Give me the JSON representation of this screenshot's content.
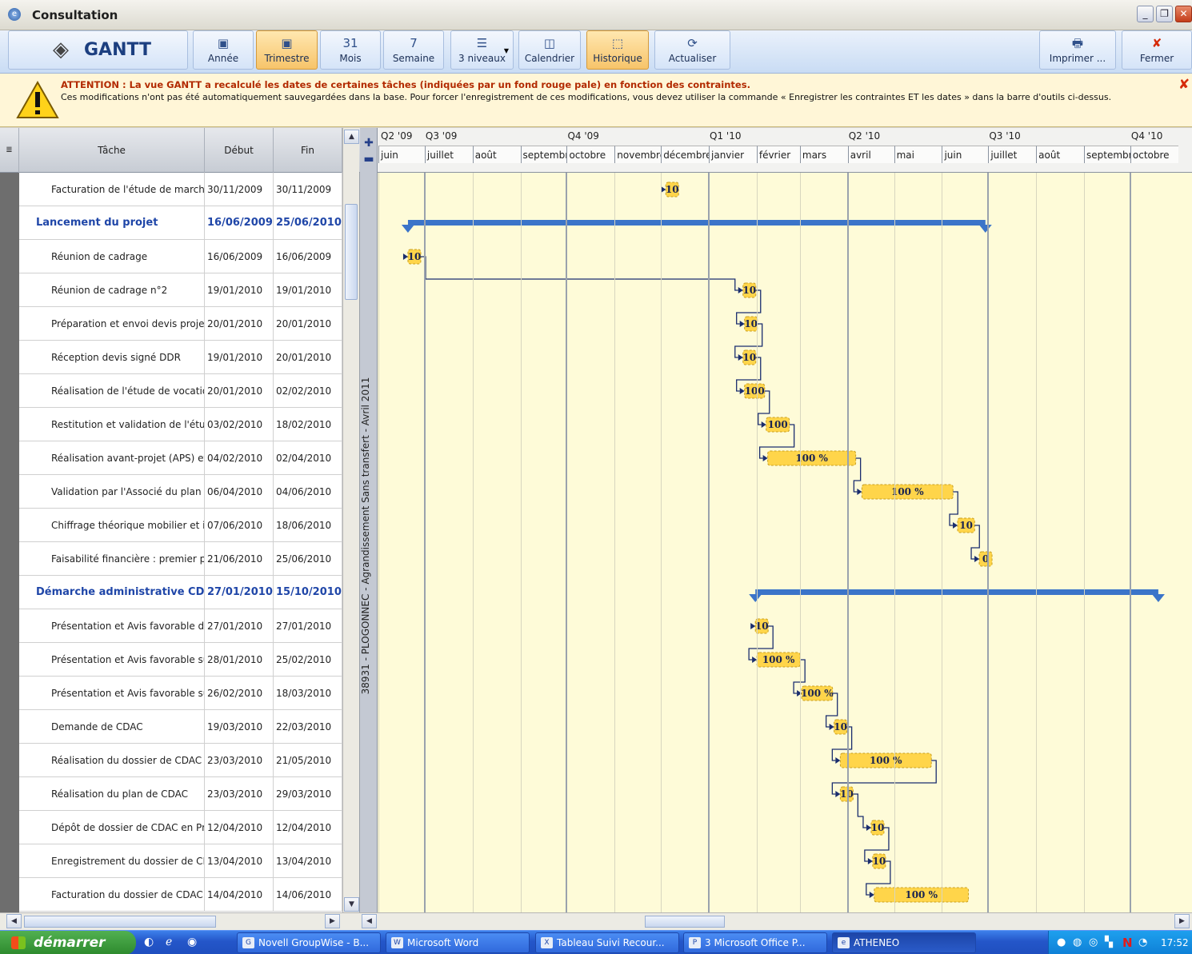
{
  "window": {
    "title": "Consultation",
    "icon": "ie-window-icon"
  },
  "toolbar": {
    "logo": "GANTT",
    "buttons": [
      {
        "label": "Année",
        "icon": "calendar-year-icon",
        "glyph": "▣"
      },
      {
        "label": "Trimestre",
        "icon": "calendar-quarter-icon",
        "glyph": "▣"
      },
      {
        "label": "Mois",
        "icon": "calendar-month-icon",
        "glyph": "31"
      },
      {
        "label": "Semaine",
        "icon": "calendar-week-icon",
        "glyph": "7"
      },
      {
        "label": "3 niveaux",
        "icon": "levels-icon",
        "glyph": "☰"
      },
      {
        "label": "Calendrier",
        "icon": "calendar-icon",
        "glyph": "◫"
      },
      {
        "label": "Historique",
        "icon": "history-icon",
        "glyph": "⬚"
      },
      {
        "label": "Actualiser",
        "icon": "refresh-icon",
        "glyph": "⟳"
      }
    ],
    "print_label": "Imprimer ...",
    "close_label": "Fermer"
  },
  "warning": {
    "title": "ATTENTION : La vue GANTT a recalculé les dates de certaines tâches (indiquées par un fond rouge pale) en fonction des contraintes.",
    "body": "Ces modifications n'ont pas été automatiquement sauvegardées dans la base. Pour forcer l'enregistrement de ces modifications, vous devez utiliser la commande « Enregistrer les contraintes ET les dates » dans la barre d'outils ci-dessus."
  },
  "table": {
    "headers": [
      "Tâche",
      "Début",
      "Fin"
    ],
    "rows": [
      {
        "task": "Facturation de l'étude de marché",
        "start": "30/11/2009",
        "end": "30/11/2009",
        "group": false
      },
      {
        "task": "Lancement du projet",
        "start": "16/06/2009",
        "end": "25/06/2010",
        "group": true
      },
      {
        "task": "Réunion de cadrage",
        "start": "16/06/2009",
        "end": "16/06/2009",
        "group": false
      },
      {
        "task": "Réunion de cadrage n°2",
        "start": "19/01/2010",
        "end": "19/01/2010",
        "group": false
      },
      {
        "task": "Préparation et envoi devis projet I",
        "start": "20/01/2010",
        "end": "20/01/2010",
        "group": false
      },
      {
        "task": "Réception devis signé DDR",
        "start": "19/01/2010",
        "end": "20/01/2010",
        "group": false
      },
      {
        "task": "Réalisation de l'étude de vocation",
        "start": "20/01/2010",
        "end": "02/02/2010",
        "group": false
      },
      {
        "task": "Restitution et validation de l'étude",
        "start": "03/02/2010",
        "end": "18/02/2010",
        "group": false
      },
      {
        "task": "Réalisation avant-projet (APS) et",
        "start": "04/02/2010",
        "end": "02/04/2010",
        "group": false
      },
      {
        "task": "Validation par l'Associé du plan AP",
        "start": "06/04/2010",
        "end": "04/06/2010",
        "group": false
      },
      {
        "task": "Chiffrage théorique mobilier et imr",
        "start": "07/06/2010",
        "end": "18/06/2010",
        "group": false
      },
      {
        "task": "Faisabilité financière : premier plar",
        "start": "21/06/2010",
        "end": "25/06/2010",
        "group": false
      },
      {
        "task": "Démarche administrative CDAC",
        "start": "27/01/2010",
        "end": "15/10/2010",
        "group": true
      },
      {
        "task": "Présentation et Avis favorable du",
        "start": "27/01/2010",
        "end": "27/01/2010",
        "group": false
      },
      {
        "task": "Présentation et Avis favorable sur",
        "start": "28/01/2010",
        "end": "25/02/2010",
        "group": false
      },
      {
        "task": "Présentation et Avis favorable sur",
        "start": "26/02/2010",
        "end": "18/03/2010",
        "group": false
      },
      {
        "task": "Demande de CDAC",
        "start": "19/03/2010",
        "end": "22/03/2010",
        "group": false
      },
      {
        "task": "Réalisation du dossier de CDAC",
        "start": "23/03/2010",
        "end": "21/05/2010",
        "group": false
      },
      {
        "task": "Réalisation du plan de CDAC",
        "start": "23/03/2010",
        "end": "29/03/2010",
        "group": false
      },
      {
        "task": "Dépôt de dossier de CDAC en Prél",
        "start": "12/04/2010",
        "end": "12/04/2010",
        "group": false
      },
      {
        "task": "Enregistrement du dossier de CDA",
        "start": "13/04/2010",
        "end": "13/04/2010",
        "group": false
      },
      {
        "task": "Facturation du dossier de CDAC",
        "start": "14/04/2010",
        "end": "14/06/2010",
        "group": false
      }
    ]
  },
  "project_label": "38931 - PLOGONNEC - Agrandissement Sans transfert - Avril 2011",
  "timeline": {
    "quarters": [
      "Q2 '09",
      "Q3 '09",
      "Q4 '09",
      "Q1 '10",
      "Q2 '10",
      "Q3 '10",
      "Q4 '10"
    ],
    "months": [
      "juin",
      "juillet",
      "août",
      "septembre",
      "octobre",
      "novembre",
      "décembre",
      "janvier",
      "février",
      "mars",
      "avril",
      "mai",
      "juin",
      "juillet",
      "août",
      "septembre",
      "octobre"
    ]
  },
  "bars": [
    {
      "row": 0,
      "label": "10",
      "start": "2009-11-30",
      "end": "2009-11-30"
    },
    {
      "row": 1,
      "summary": true,
      "start": "2009-06-16",
      "end": "2010-06-25"
    },
    {
      "row": 2,
      "label": "10",
      "start": "2009-06-16",
      "end": "2009-06-16"
    },
    {
      "row": 3,
      "label": "10",
      "start": "2010-01-19",
      "end": "2010-01-19"
    },
    {
      "row": 4,
      "label": "10",
      "start": "2010-01-20",
      "end": "2010-01-20"
    },
    {
      "row": 5,
      "label": "10",
      "start": "2010-01-19",
      "end": "2010-01-20"
    },
    {
      "row": 6,
      "label": "100",
      "start": "2010-01-20",
      "end": "2010-02-02"
    },
    {
      "row": 7,
      "label": "100",
      "start": "2010-02-03",
      "end": "2010-02-18"
    },
    {
      "row": 8,
      "label": "100 %",
      "start": "2010-02-04",
      "end": "2010-04-02"
    },
    {
      "row": 9,
      "label": "100 %",
      "start": "2010-04-06",
      "end": "2010-06-04"
    },
    {
      "row": 10,
      "label": "10",
      "start": "2010-06-07",
      "end": "2010-06-18"
    },
    {
      "row": 11,
      "label": "0",
      "start": "2010-06-21",
      "end": "2010-06-25"
    },
    {
      "row": 12,
      "summary": true,
      "start": "2010-01-27",
      "end": "2010-10-15"
    },
    {
      "row": 13,
      "label": "10",
      "start": "2010-01-27",
      "end": "2010-01-27"
    },
    {
      "row": 14,
      "label": "100 %",
      "start": "2010-01-28",
      "end": "2010-02-25"
    },
    {
      "row": 15,
      "label": "100 %",
      "start": "2010-02-26",
      "end": "2010-03-18"
    },
    {
      "row": 16,
      "label": "10",
      "start": "2010-03-19",
      "end": "2010-03-22"
    },
    {
      "row": 17,
      "label": "100 %",
      "start": "2010-03-23",
      "end": "2010-05-21"
    },
    {
      "row": 18,
      "label": "10",
      "start": "2010-03-23",
      "end": "2010-03-29"
    },
    {
      "row": 19,
      "label": "10",
      "start": "2010-04-12",
      "end": "2010-04-12"
    },
    {
      "row": 20,
      "label": "10",
      "start": "2010-04-13",
      "end": "2010-04-13"
    },
    {
      "row": 21,
      "label": "100 %",
      "start": "2010-04-14",
      "end": "2010-06-14"
    }
  ],
  "taskbar": {
    "start_label": "démarrer",
    "items": [
      {
        "label": "Novell GroupWise - B...",
        "icon": "groupwise-icon",
        "glyph": "G"
      },
      {
        "label": "Microsoft Word",
        "icon": "word-icon",
        "glyph": "W"
      },
      {
        "label": "Tableau Suivi Recour...",
        "icon": "excel-icon",
        "glyph": "X"
      },
      {
        "label": "3 Microsoft Office P...",
        "icon": "powerpoint-icon",
        "glyph": "P"
      },
      {
        "label": "ATHENEO",
        "icon": "ie-icon",
        "glyph": "e"
      }
    ],
    "clock": "17:52"
  }
}
